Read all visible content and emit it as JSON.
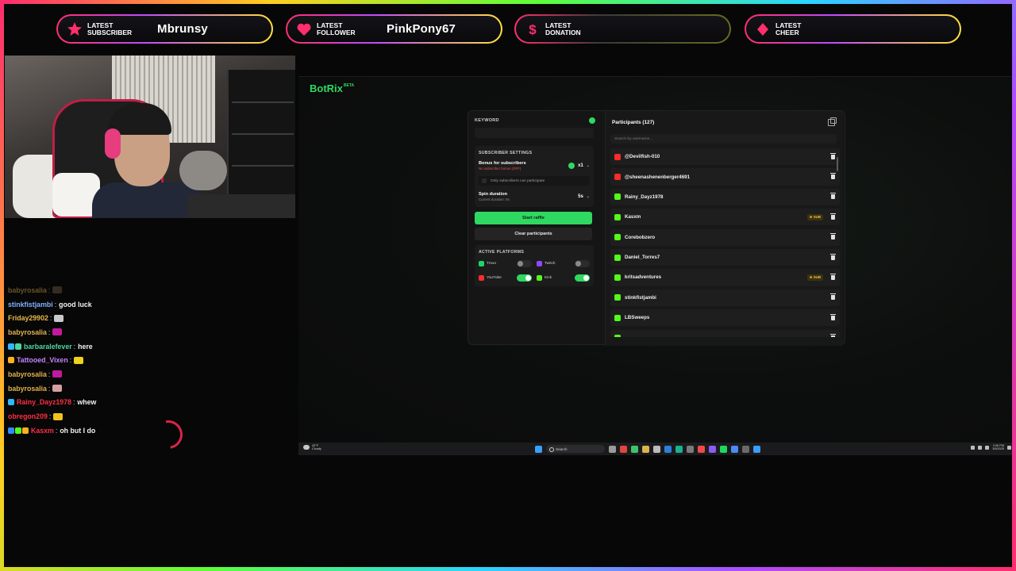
{
  "alerts": [
    {
      "label_line1": "LATEST",
      "label_line2": "SUBSCRIBER",
      "value": "Mbrunsy",
      "icon": "star-icon",
      "color": "#ff2f6d"
    },
    {
      "label_line1": "LATEST",
      "label_line2": "FOLLOWER",
      "value": "PinkPony67",
      "icon": "heart-icon",
      "color": "#ff2f6d"
    },
    {
      "label_line1": "LATEST",
      "label_line2": "DONATION",
      "value": "",
      "icon": "dollar-icon",
      "color": "#ff2f6d"
    },
    {
      "label_line1": "LATEST",
      "label_line2": "CHEER",
      "value": "",
      "icon": "diamond-icon",
      "color": "#ff2f6d"
    }
  ],
  "chat": [
    {
      "user": "babyrosalia",
      "message": "",
      "color": "#e0b14c",
      "faded": true,
      "emote": "#6b5a3a"
    },
    {
      "user": "stinkfistjambi",
      "message": "good luck",
      "color": "#7fb1ff"
    },
    {
      "user": "Friday29902",
      "message": "",
      "color": "#e8b84a",
      "emote": "#c9c9c9"
    },
    {
      "user": "babyrosalia",
      "message": "",
      "color": "#e0b14c",
      "emote": "#c21a9c"
    },
    {
      "user": "barbaralefever",
      "message": "here",
      "color": "#4cd6a0",
      "badges": [
        "#2fb8ff",
        "#4cd6a0"
      ]
    },
    {
      "user": "Tattooed_Vixen",
      "message": "",
      "color": "#c583ff",
      "badges": [
        "#ffb020"
      ],
      "emote": "#f0d21c"
    },
    {
      "user": "babyrosalia",
      "message": "",
      "color": "#e0b14c",
      "emote": "#c21a9c"
    },
    {
      "user": "babyrosalia",
      "message": "",
      "color": "#e0b14c",
      "emote": "#d7a0a0"
    },
    {
      "user": "Rainy_Dayz1978",
      "message": "whew",
      "color": "#ff2e43",
      "badges": [
        "#2fb8ff"
      ]
    },
    {
      "user": "obregon209",
      "message": "",
      "color": "#ff2e43",
      "emote": "#f0c21c"
    },
    {
      "user": "Kasxm",
      "message": "oh but I do",
      "color": "#ff2e43",
      "badges": [
        "#2f8bff",
        "#53fc18",
        "#ffb020"
      ]
    }
  ],
  "botrix": {
    "brand": "BotRix",
    "beta": "BETA",
    "keyword_label": "KEYWORD",
    "subscriber_settings_title": "SUBSCRIBER SETTINGS",
    "bonus_title": "Bonus for subscribers",
    "bonus_sub": "No subscriber bonus (OFF)",
    "bonus_value": "x1",
    "only_subs_label": "Only subscribers can participate",
    "spin_title": "Spin duration",
    "spin_sub": "Current duration: 5s",
    "spin_value": "5s",
    "start_button": "Start raffle",
    "clear_button": "Clear participants",
    "active_platforms_title": "ACTIVE PLATFORMS",
    "platforms": [
      {
        "name": "Trovo",
        "enabled": false,
        "color": "#19d66b"
      },
      {
        "name": "Twitch",
        "enabled": false,
        "color": "#9146ff"
      },
      {
        "name": "YouTube",
        "enabled": true,
        "color": "#ff2b2b"
      },
      {
        "name": "Kick",
        "enabled": true,
        "color": "#53fc18"
      }
    ],
    "participants_title": "Participants (127)",
    "search_placeholder": "Search by username...",
    "participants": [
      {
        "name": "@Devilfish-010",
        "platform": "youtube",
        "sub": ""
      },
      {
        "name": "@sheenashenenberger4691",
        "platform": "youtube",
        "sub": ""
      },
      {
        "name": "Rainy_Dayz1978",
        "platform": "kick",
        "sub": ""
      },
      {
        "name": "Kasxm",
        "platform": "kick",
        "sub": "★ SUB"
      },
      {
        "name": "Corebobzero",
        "platform": "kick",
        "sub": ""
      },
      {
        "name": "Daniel_Torres7",
        "platform": "kick",
        "sub": ""
      },
      {
        "name": "kritsadventures",
        "platform": "kick",
        "sub": "★ SUB"
      },
      {
        "name": "stinkfistjambi",
        "platform": "kick",
        "sub": ""
      },
      {
        "name": "LBSweeps",
        "platform": "kick",
        "sub": ""
      },
      {
        "name": "",
        "platform": "kick",
        "sub": ""
      }
    ]
  },
  "taskbar": {
    "weather_temp": "42°F",
    "weather_desc": "Cloudy",
    "search_label": "Search",
    "time": "2:06 PM",
    "date": "3/5/2025"
  }
}
